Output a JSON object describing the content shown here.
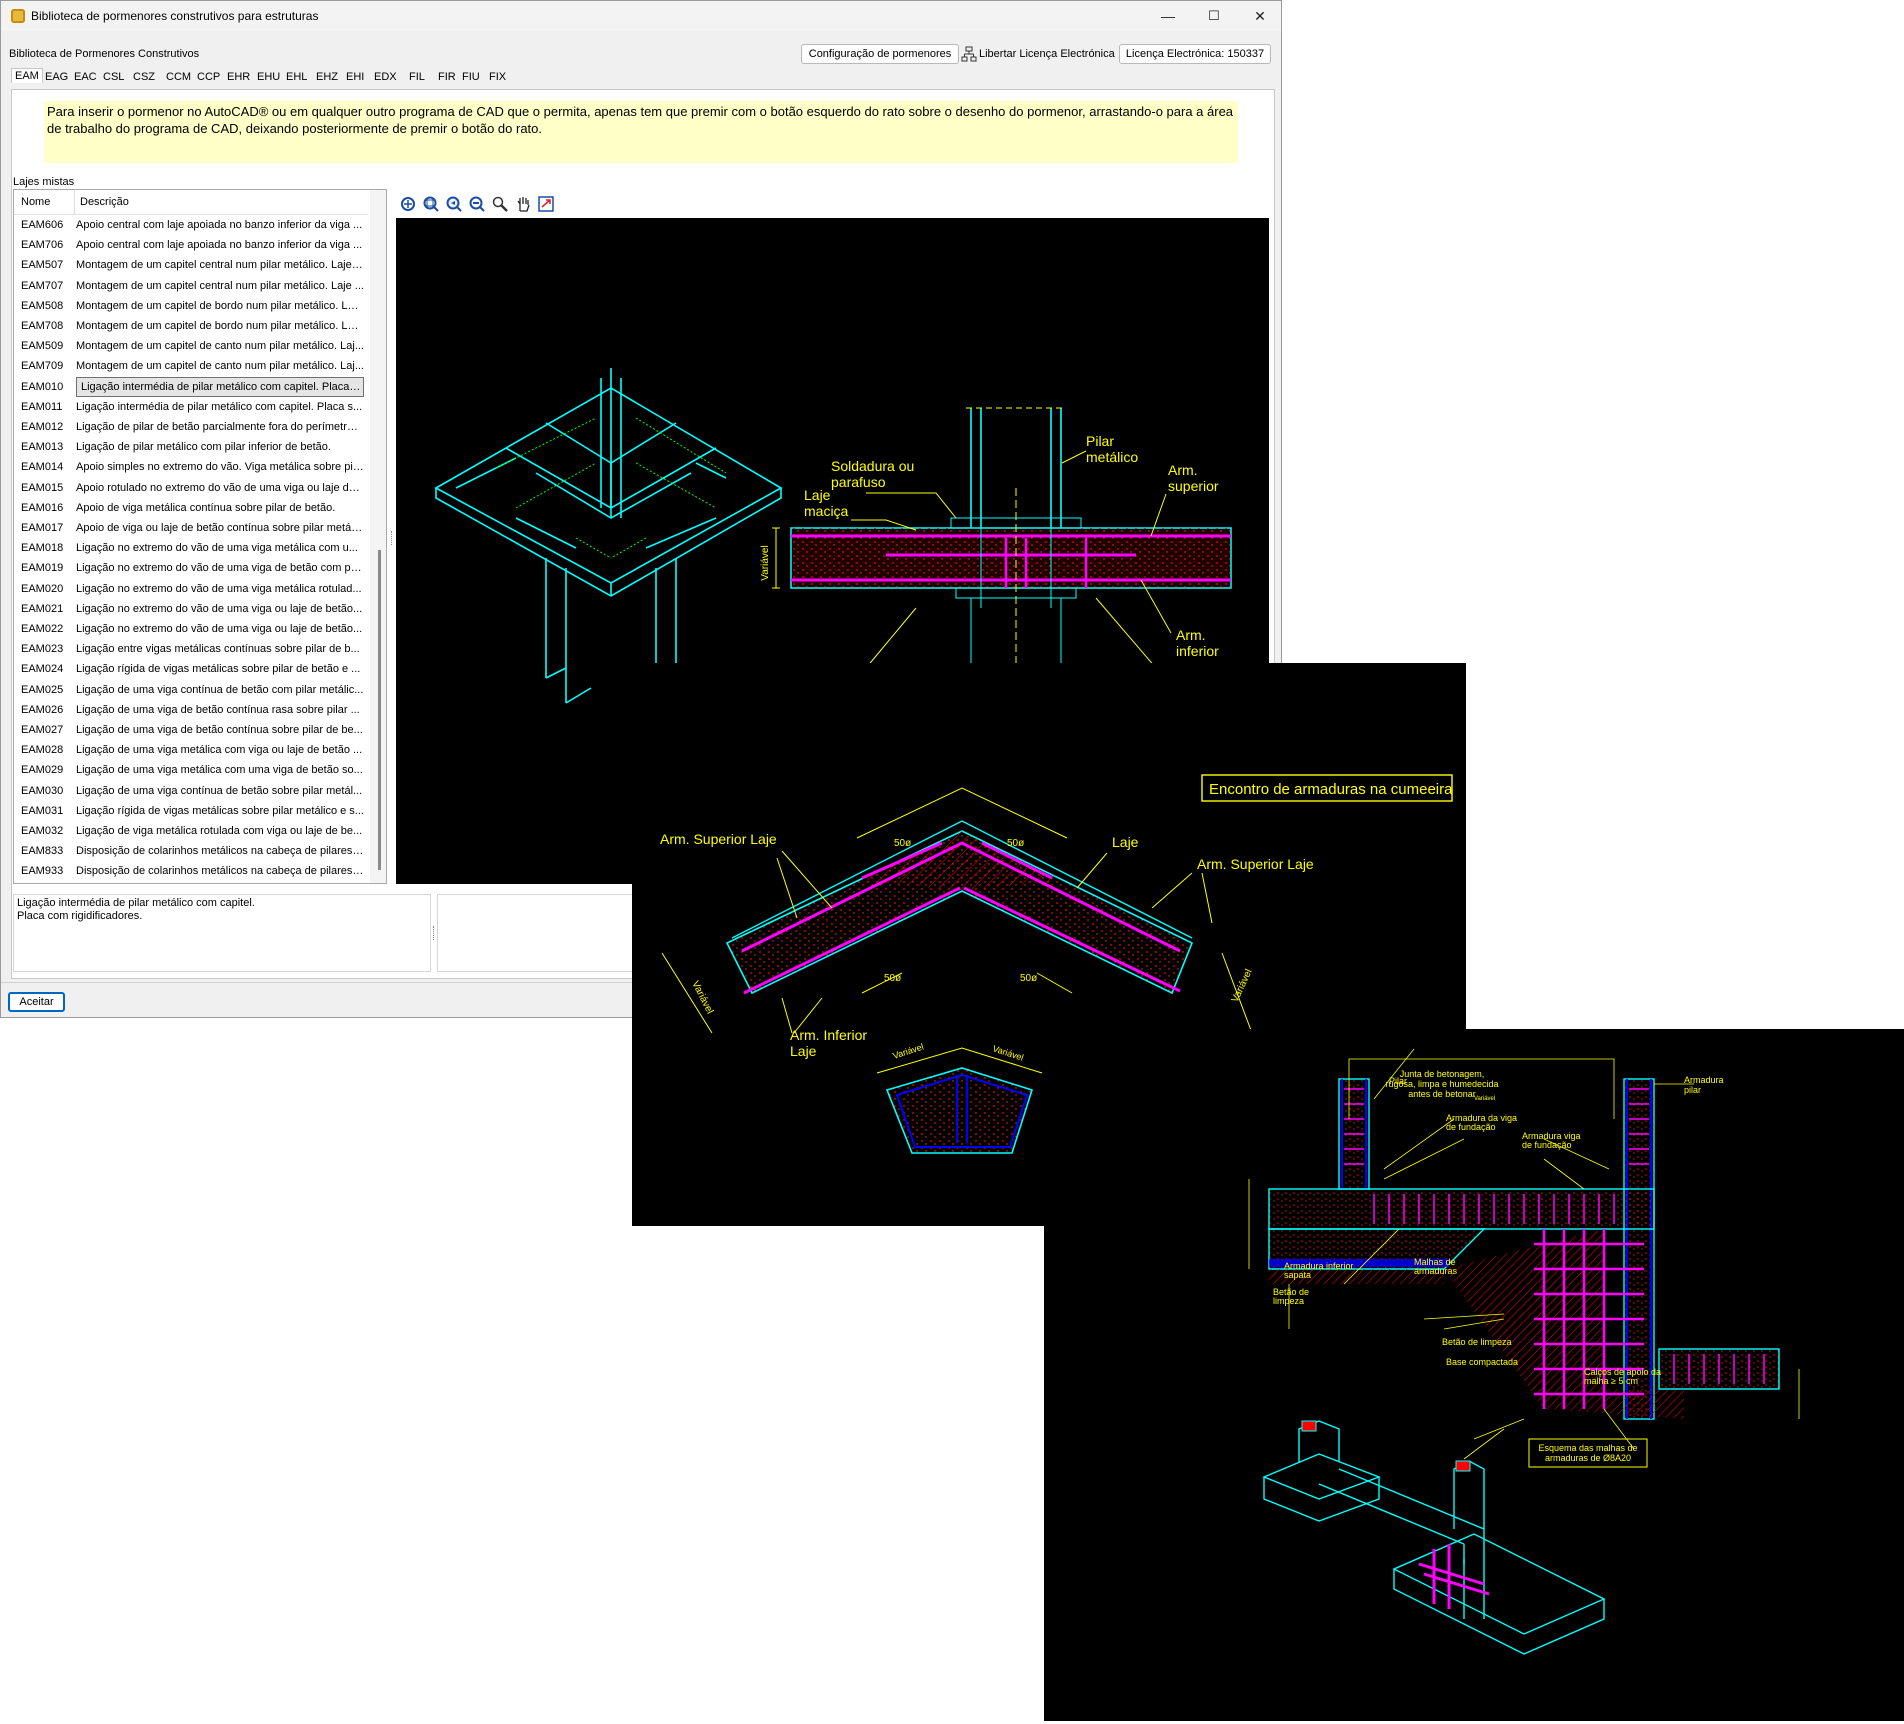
{
  "window": {
    "title": "Biblioteca de pormenores construtivos para estruturas",
    "minimize_glyph": "—",
    "maximize_glyph": "☐",
    "close_glyph": "✕"
  },
  "header": {
    "label": "Biblioteca de Pormenores Construtivos",
    "config_button": "Configuração de pormenores",
    "release_license": "Libertar Licença Electrónica",
    "license_label": "Licença Electrónica: 150337"
  },
  "tabs": [
    "EAM",
    "EAG",
    "EAC",
    "CSL",
    "CSZ",
    "CCM",
    "CCP",
    "EHR",
    "EHU",
    "EHL",
    "EHZ",
    "EHI",
    "EDX",
    "FIL",
    "FIR",
    "FIU",
    "FIX"
  ],
  "info_text": "Para inserir o pormenor no AutoCAD® ou em qualquer outro programa de CAD que o permita, apenas tem que premir com o botão esquerdo do rato sobre o desenho do pormenor, arrastando-o para a área de trabalho do programa de CAD, deixando posteriormente de premir o botão do rato.",
  "group_label": "Lajes mistas",
  "list": {
    "col_name": "Nome",
    "col_desc": "Descrição",
    "selected_index": 8,
    "rows": [
      {
        "name": "EAM606",
        "desc": "Apoio central com laje apoiada no banzo inferior da viga ..."
      },
      {
        "name": "EAM706",
        "desc": "Apoio central com laje apoiada no banzo inferior da viga ..."
      },
      {
        "name": "EAM507",
        "desc": "Montagem de um capitel central num pilar metálico. Lajes..."
      },
      {
        "name": "EAM707",
        "desc": "Montagem de um capitel central num pilar metálico. Laje ..."
      },
      {
        "name": "EAM508",
        "desc": "Montagem de um capitel de bordo num pilar metálico. Laj..."
      },
      {
        "name": "EAM708",
        "desc": "Montagem de um capitel de bordo num pilar metálico. Laj..."
      },
      {
        "name": "EAM509",
        "desc": "Montagem de um capitel de canto num pilar metálico. Laj..."
      },
      {
        "name": "EAM709",
        "desc": "Montagem de um capitel de canto num pilar metálico. Laj..."
      },
      {
        "name": "EAM010",
        "desc": "Ligação intermédia de pilar metálico com capitel. Placa c..."
      },
      {
        "name": "EAM011",
        "desc": "Ligação intermédia de pilar metálico com capitel. Placa s..."
      },
      {
        "name": "EAM012",
        "desc": "Ligação de pilar de betão parcialmente fora do perímetro ..."
      },
      {
        "name": "EAM013",
        "desc": "Ligação de pilar metálico com pilar inferior de betão."
      },
      {
        "name": "EAM014",
        "desc": "Apoio simples no extremo do vão. Viga metálica sobre pil..."
      },
      {
        "name": "EAM015",
        "desc": "Apoio rotulado no extremo do vão de uma viga ou laje de..."
      },
      {
        "name": "EAM016",
        "desc": "Apoio de viga metálica contínua sobre pilar de betão."
      },
      {
        "name": "EAM017",
        "desc": "Apoio de viga ou laje de betão contínua sobre pilar metáli..."
      },
      {
        "name": "EAM018",
        "desc": "Ligação no extremo do vão de uma viga metálica com u..."
      },
      {
        "name": "EAM019",
        "desc": "Ligação no extremo do vão de uma viga de betão com pil..."
      },
      {
        "name": "EAM020",
        "desc": "Ligação no extremo do vão de uma viga metálica rotulad..."
      },
      {
        "name": "EAM021",
        "desc": "Ligação no extremo do vão de uma viga ou laje de betão..."
      },
      {
        "name": "EAM022",
        "desc": "Ligação no extremo do vão de uma viga ou laje de betão..."
      },
      {
        "name": "EAM023",
        "desc": "Ligação entre vigas metálicas contínuas sobre pilar de b..."
      },
      {
        "name": "EAM024",
        "desc": "Ligação rígida de vigas metálicas sobre pilar de betão e ..."
      },
      {
        "name": "EAM025",
        "desc": "Ligação de uma viga contínua de betão com pilar metálic..."
      },
      {
        "name": "EAM026",
        "desc": "Ligação de uma viga de betão contínua rasa sobre pilar ..."
      },
      {
        "name": "EAM027",
        "desc": "Ligação de uma viga de betão contínua sobre pilar de be..."
      },
      {
        "name": "EAM028",
        "desc": "Ligação de uma viga metálica com viga ou laje de betão ..."
      },
      {
        "name": "EAM029",
        "desc": "Ligação de uma viga metálica com uma viga de betão so..."
      },
      {
        "name": "EAM030",
        "desc": "Ligação de uma viga contínua de betão sobre pilar metál..."
      },
      {
        "name": "EAM031",
        "desc": "Ligação rígida de vigas metálicas sobre pilar metálico e s..."
      },
      {
        "name": "EAM032",
        "desc": "Ligação de viga metálica rotulada com viga ou laje de be..."
      },
      {
        "name": "EAM833",
        "desc": "Disposição de colarinhos metálicos na cabeça de pilares ..."
      },
      {
        "name": "EAM933",
        "desc": "Disposição de colarinhos metálicos na cabeça de pilares ..."
      }
    ]
  },
  "toolbar_icons": [
    "zoom-extents-icon",
    "zoom-window-icon",
    "zoom-previous-icon",
    "zoom-realtime-icon",
    "zoom-in-icon",
    "pan-hand-icon",
    "regenerate-icon"
  ],
  "description_line1": "Ligação intermédia de pilar metálico com capitel.",
  "description_line2": "Placa com rigidificadores.",
  "accept_button": "Aceitar",
  "drawing1": {
    "pilar": "Pilar",
    "metalico": "metálico",
    "soldadura": "Soldadura ou",
    "parafuso": "parafuso",
    "laje": "Laje",
    "macica": "maciça",
    "arm": "Arm.",
    "superior": "superior",
    "inferior": "inferior",
    "variavel": "Variável"
  },
  "drawing2": {
    "title": "Encontro de armaduras na cumeeira",
    "arm_sup": "Arm. Superior Laje",
    "laje": "Laje",
    "arm_inf": "Arm. Inferior",
    "laje2": "Laje",
    "dim50": "50ø",
    "variavel": "Variável"
  },
  "drawing3": {
    "junta1": "Junta de betonagem,",
    "junta2": "rugosa, limpa e humedecida",
    "junta3": "antes de betonar",
    "pilar": "Pilar",
    "armadura_pilar1": "Armadura",
    "armadura_pilar2": "pilar",
    "arm_viga1": "Armadura da viga",
    "arm_viga2": "de fundação",
    "arm_viga3": "Armadura viga",
    "arm_viga4": "de fundação",
    "arm_inf1": "Armadura inferior",
    "arm_inf2": "sapata",
    "malhas1": "Malhas de",
    "malhas2": "armaduras",
    "betao1": "Betão de",
    "betao2": "limpeza",
    "betao3": "Betão de limpeza",
    "base": "Base compactada",
    "calcos1": "Calços de apoio da",
    "calcos2": "malha ≥ 5 cm",
    "esquema1": "Esquema das malhas de",
    "esquema2": "armaduras de Ø8A20",
    "variavel": "Variável"
  },
  "colors": {
    "cad_bg": "#000000",
    "cyan": "#00ffff",
    "yellow": "#ffff00",
    "magenta": "#ff00ff",
    "red": "#ff0000",
    "blue": "#0000ff",
    "info_bg": "#ffffc8"
  }
}
